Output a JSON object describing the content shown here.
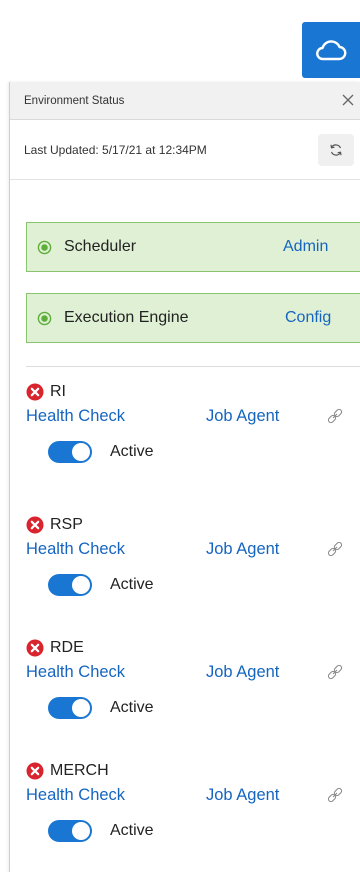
{
  "launcher": {
    "icon": "cloud-icon"
  },
  "panel": {
    "title": "Environment Status",
    "close_icon": "close-icon",
    "last_updated": "Last Updated: 5/17/21 at 12:34PM",
    "refresh_icon": "refresh-icon"
  },
  "services": [
    {
      "name": "Scheduler",
      "link": "Admin",
      "status": "running"
    },
    {
      "name": "Execution Engine",
      "link": "Config",
      "status": "running"
    }
  ],
  "apps": [
    {
      "name": "RI",
      "health_label": "Health Check",
      "agent_label": "Job Agent",
      "toggle_label": "Active",
      "active": true,
      "status": "error"
    },
    {
      "name": "RSP",
      "health_label": "Health Check",
      "agent_label": "Job Agent",
      "toggle_label": "Active",
      "active": true,
      "status": "error"
    },
    {
      "name": "RDE",
      "health_label": "Health Check",
      "agent_label": "Job Agent",
      "toggle_label": "Active",
      "active": true,
      "status": "error"
    },
    {
      "name": "MERCH",
      "health_label": "Health Check",
      "agent_label": "Job Agent",
      "toggle_label": "Active",
      "active": true,
      "status": "error"
    }
  ],
  "colors": {
    "accent": "#1976d2",
    "link": "#1565c0",
    "success_bg": "#dff0d4",
    "success_border": "#8ac46e",
    "error": "#d9232d"
  }
}
